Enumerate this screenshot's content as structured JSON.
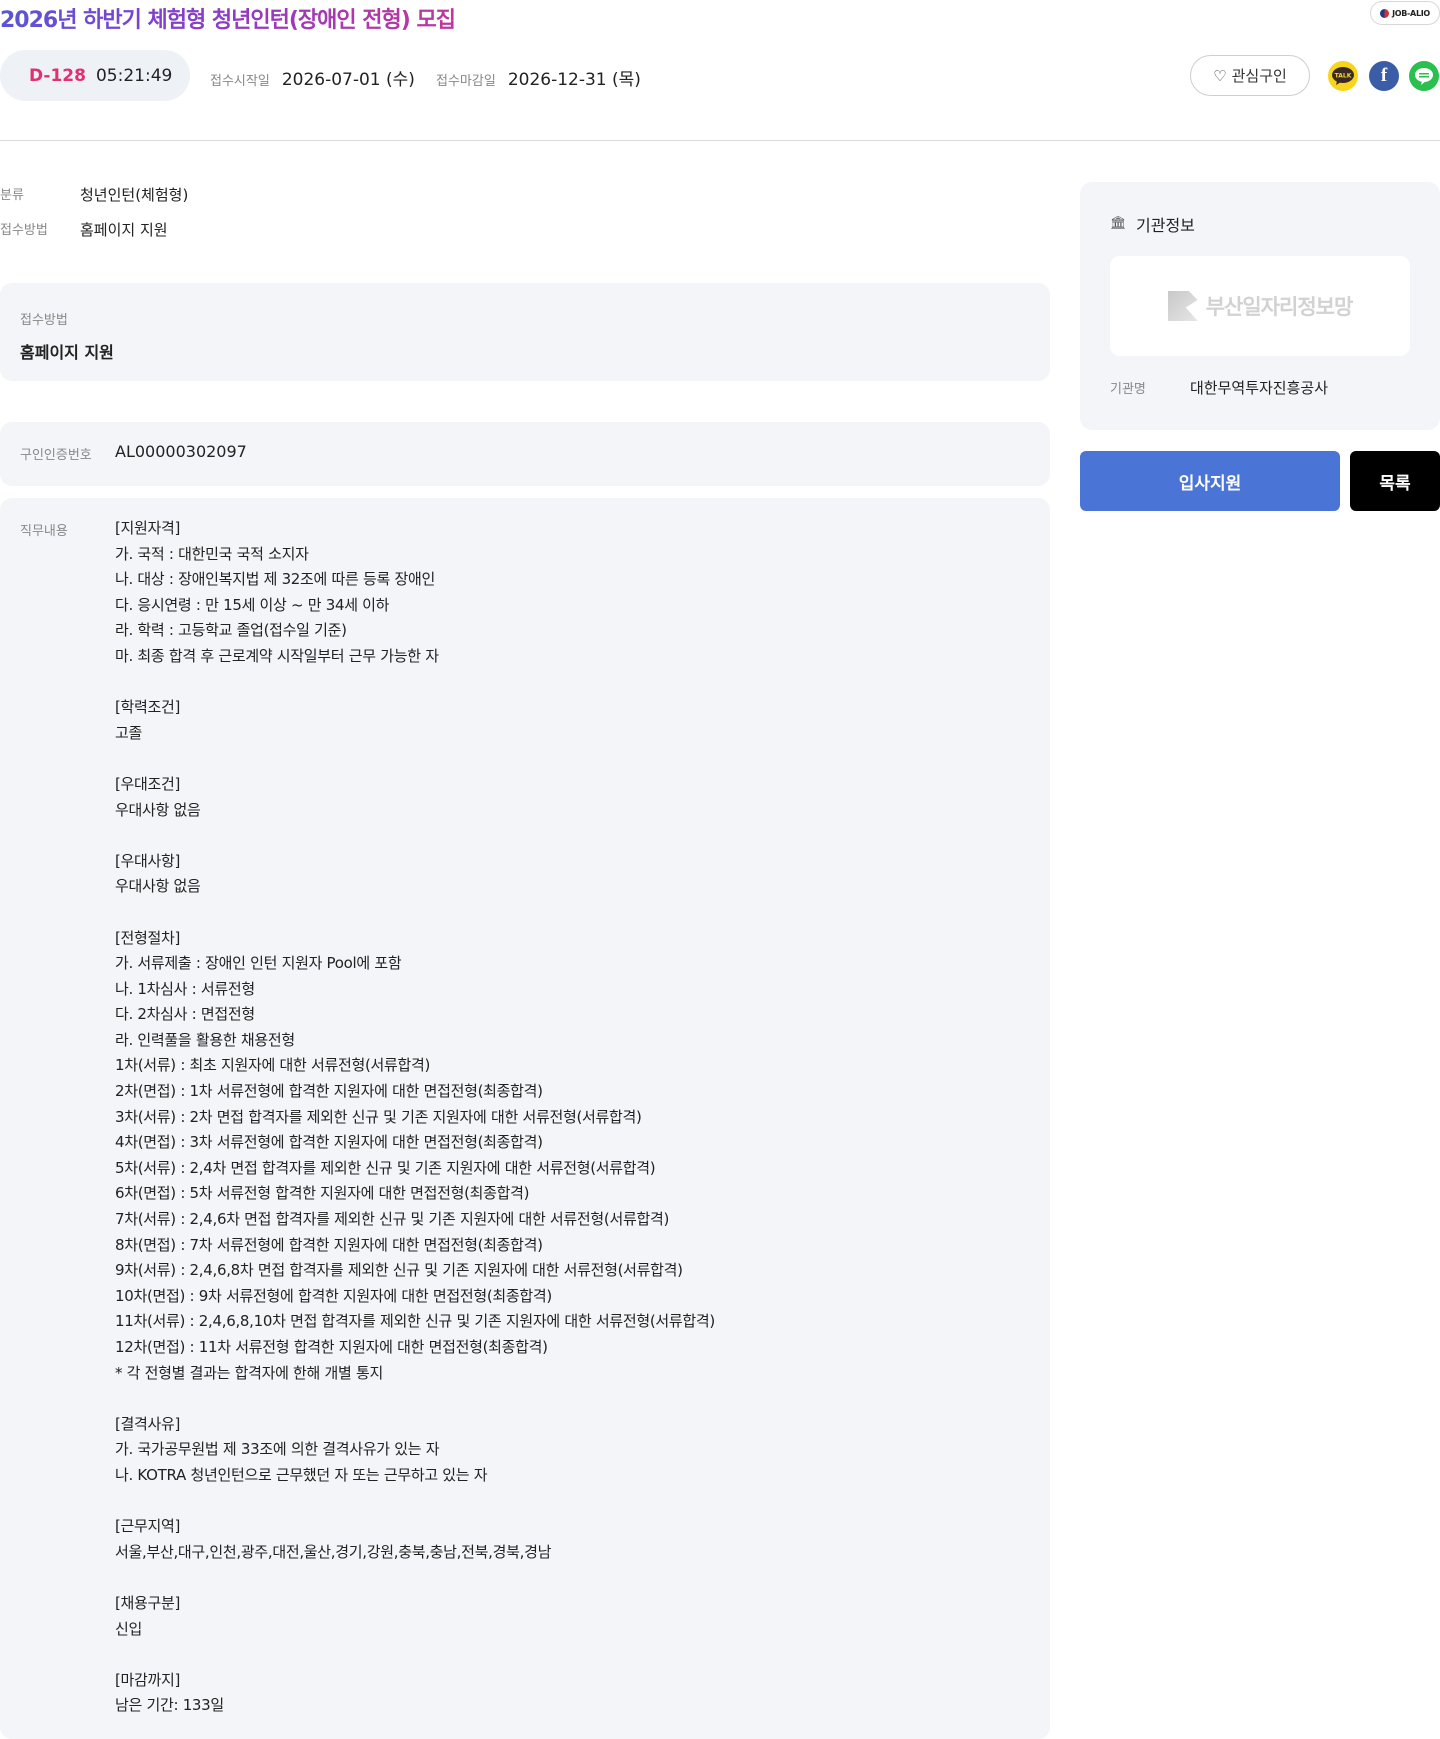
{
  "header": {
    "title": "2026년 하반기 체험형 청년인턴(장애인 전형) 모집",
    "badge": "JOB-ALIO"
  },
  "deadline": {
    "dday": "D-128",
    "timer": "05:21:49",
    "start_label": "접수시작일",
    "start_value": "2026-07-01 (수)",
    "end_label": "접수마감일",
    "end_value": "2026-12-31 (목)"
  },
  "actions": {
    "interest_label": "관심구인",
    "kakao_label": "TALK",
    "facebook_label": "f"
  },
  "meta": {
    "category_label": "분류",
    "category_value": "청년인턴(체험형)",
    "method_label": "접수방법",
    "method_value": "홈페이지 지원"
  },
  "panel_method": {
    "label": "접수방법",
    "value": "홈페이지 지원"
  },
  "panel_cert": {
    "label": "구인인증번호",
    "value": "AL00000302097"
  },
  "panel_job": {
    "label": "직무내용",
    "text": "[지원자격]\n가. 국적 : 대한민국 국적 소지자\n나. 대상 : 장애인복지법 제 32조에 따른 등록 장애인\n다. 응시연령 : 만 15세 이상 ~ 만 34세 이하\n라. 학력 : 고등학교 졸업(접수일 기준)\n마. 최종 합격 후 근로계약 시작일부터 근무 가능한 자\n\n[학력조건]\n고졸\n\n[우대조건]\n우대사항 없음\n\n[우대사항]\n우대사항 없음\n\n[전형절차]\n가. 서류제출 : 장애인 인턴 지원자 Pool에 포함\n나. 1차심사 : 서류전형\n다. 2차심사 : 면접전형\n라. 인력풀을 활용한 채용전형\n1차(서류) : 최초 지원자에 대한 서류전형(서류합격)\n2차(면접) : 1차 서류전형에 합격한 지원자에 대한 면접전형(최종합격)\n3차(서류) : 2차 면접 합격자를 제외한 신규 및 기존 지원자에 대한 서류전형(서류합격)\n4차(면접) : 3차 서류전형에 합격한 지원자에 대한 면접전형(최종합격)\n5차(서류) : 2,4차 면접 합격자를 제외한 신규 및 기존 지원자에 대한 서류전형(서류합격)\n6차(면접) : 5차 서류전형 합격한 지원자에 대한 면접전형(최종합격)\n7차(서류) : 2,4,6차 면접 합격자를 제외한 신규 및 기존 지원자에 대한 서류전형(서류합격)\n8차(면접) : 7차 서류전형에 합격한 지원자에 대한 면접전형(최종합격)\n9차(서류) : 2,4,6,8차 면접 합격자를 제외한 신규 및 기존 지원자에 대한 서류전형(서류합격)\n10차(면접) : 9차 서류전형에 합격한 지원자에 대한 면접전형(최종합격)\n11차(서류) : 2,4,6,8,10차 면접 합격자를 제외한 신규 및 기존 지원자에 대한 서류전형(서류합격)\n12차(면접) : 11차 서류전형 합격한 지원자에 대한 면접전형(최종합격)\n* 각 전형별 결과는 합격자에 한해 개별 통지\n\n[결격사유]\n가. 국가공무원법 제 33조에 의한 결격사유가 있는 자\n나. KOTRA 청년인턴으로 근무했던 자 또는 근무하고 있는 자\n\n[근무지역]\n서울,부산,대구,인천,광주,대전,울산,경기,강원,충북,충남,전북,경북,경남\n\n[채용구분]\n신입\n\n[마감까지]\n남은 기간: 133일"
  },
  "sidebar": {
    "heading": "기관정보",
    "logo_text": "부산일자리정보망",
    "org_label": "기관명",
    "org_value": "대한무역투자진흥공사",
    "apply_label": "입사지원",
    "list_label": "목록"
  },
  "colors": {
    "accent_blue": "#4a74d6",
    "dday_red": "#e0306f",
    "panel_bg": "#f3f5f8"
  }
}
